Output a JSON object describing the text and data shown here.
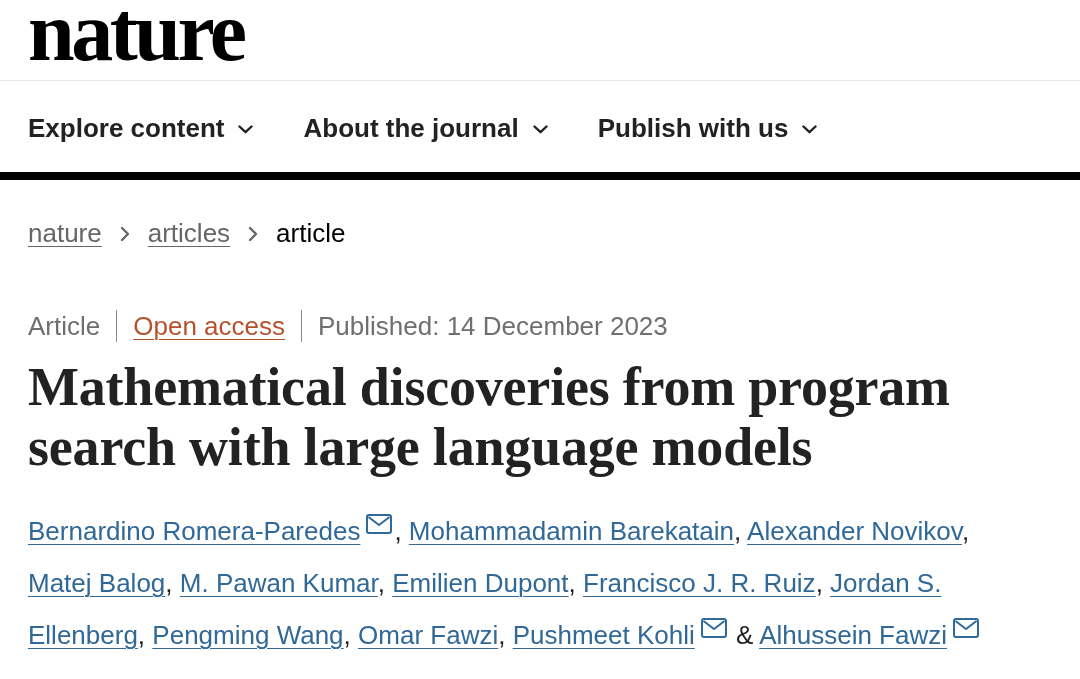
{
  "header": {
    "logo": "nature"
  },
  "nav": [
    {
      "label": "Explore content"
    },
    {
      "label": "About the journal"
    },
    {
      "label": "Publish with us"
    }
  ],
  "breadcrumbs": [
    {
      "label": "nature",
      "current": false
    },
    {
      "label": "articles",
      "current": false
    },
    {
      "label": "article",
      "current": true
    }
  ],
  "article": {
    "type": "Article",
    "access": "Open access",
    "published": "Published: 14 December 2023",
    "title": "Mathematical discoveries from program search with large language models",
    "authors": [
      {
        "name": "Bernardino Romera-Paredes",
        "corresponding": true,
        "separator": ","
      },
      {
        "name": "Mohammadamin Barekatain",
        "corresponding": false,
        "separator": ","
      },
      {
        "name": "Alexander Novikov",
        "corresponding": false,
        "separator": ","
      },
      {
        "name": "Matej Balog",
        "corresponding": false,
        "separator": ","
      },
      {
        "name": "M. Pawan Kumar",
        "corresponding": false,
        "separator": ","
      },
      {
        "name": "Emilien Dupont",
        "corresponding": false,
        "separator": ","
      },
      {
        "name": "Francisco J. R. Ruiz",
        "corresponding": false,
        "separator": ","
      },
      {
        "name": "Jordan S.",
        "name_continued": "Ellenberg",
        "corresponding": false,
        "separator": ","
      },
      {
        "name": "Pengming Wang",
        "corresponding": false,
        "separator": ","
      },
      {
        "name": "Omar Fawzi",
        "corresponding": false,
        "separator": ","
      },
      {
        "name": "Pushmeet Kohli",
        "corresponding": true,
        "separator": " &"
      },
      {
        "name": "Alhussein Fawzi",
        "corresponding": true
      }
    ]
  }
}
